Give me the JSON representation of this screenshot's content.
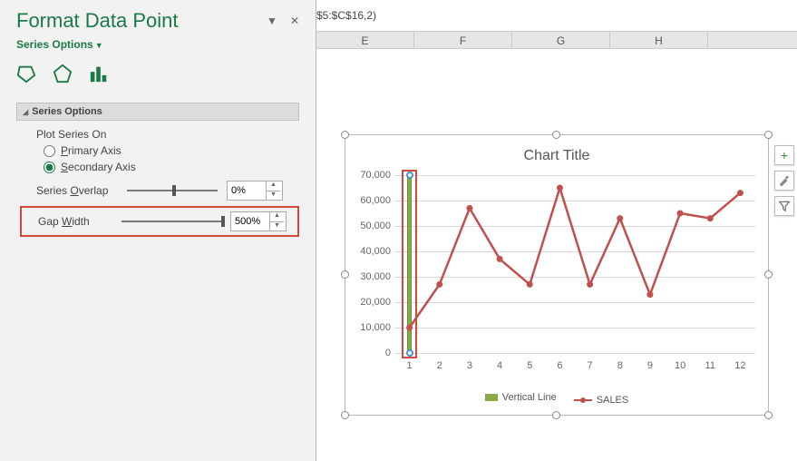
{
  "formula_fragment": "$5:$C$16,2)",
  "columns": [
    "E",
    "F",
    "G",
    "H"
  ],
  "pane": {
    "title": "Format Data Point",
    "dropdown_btn": "▼",
    "close_btn": "✕",
    "subtitle": "Series Options",
    "section_header": "Series Options",
    "plot_on_label": "Plot Series On",
    "primary_label": "Primary Axis",
    "secondary_label": "Secondary Axis",
    "overlap_label": "Series Overlap",
    "overlap_value": "0%",
    "gap_label": "Gap Width",
    "gap_value": "500%"
  },
  "side_buttons": {
    "plus": "+",
    "brush": "🖌",
    "filter": "▾"
  },
  "chart_data": {
    "type": "line",
    "title": "Chart Title",
    "categories": [
      1,
      2,
      3,
      4,
      5,
      6,
      7,
      8,
      9,
      10,
      11,
      12
    ],
    "series": [
      {
        "name": "Vertical Line",
        "type": "bar",
        "values": [
          70000,
          0,
          0,
          0,
          0,
          0,
          0,
          0,
          0,
          0,
          0,
          0
        ]
      },
      {
        "name": "SALES",
        "type": "line",
        "values": [
          10000,
          27000,
          57000,
          37000,
          27000,
          65000,
          27000,
          53000,
          23000,
          55000,
          53000,
          63000
        ]
      }
    ],
    "ylim": [
      0,
      70000
    ],
    "yticks": [
      0,
      10000,
      20000,
      30000,
      40000,
      50000,
      60000,
      70000
    ],
    "ytick_labels": [
      "0",
      "10,000",
      "20,000",
      "30,000",
      "40,000",
      "50,000",
      "60,000",
      "70,000"
    ],
    "legend": {
      "vertical_line": "Vertical Line",
      "sales": "SALES"
    }
  }
}
